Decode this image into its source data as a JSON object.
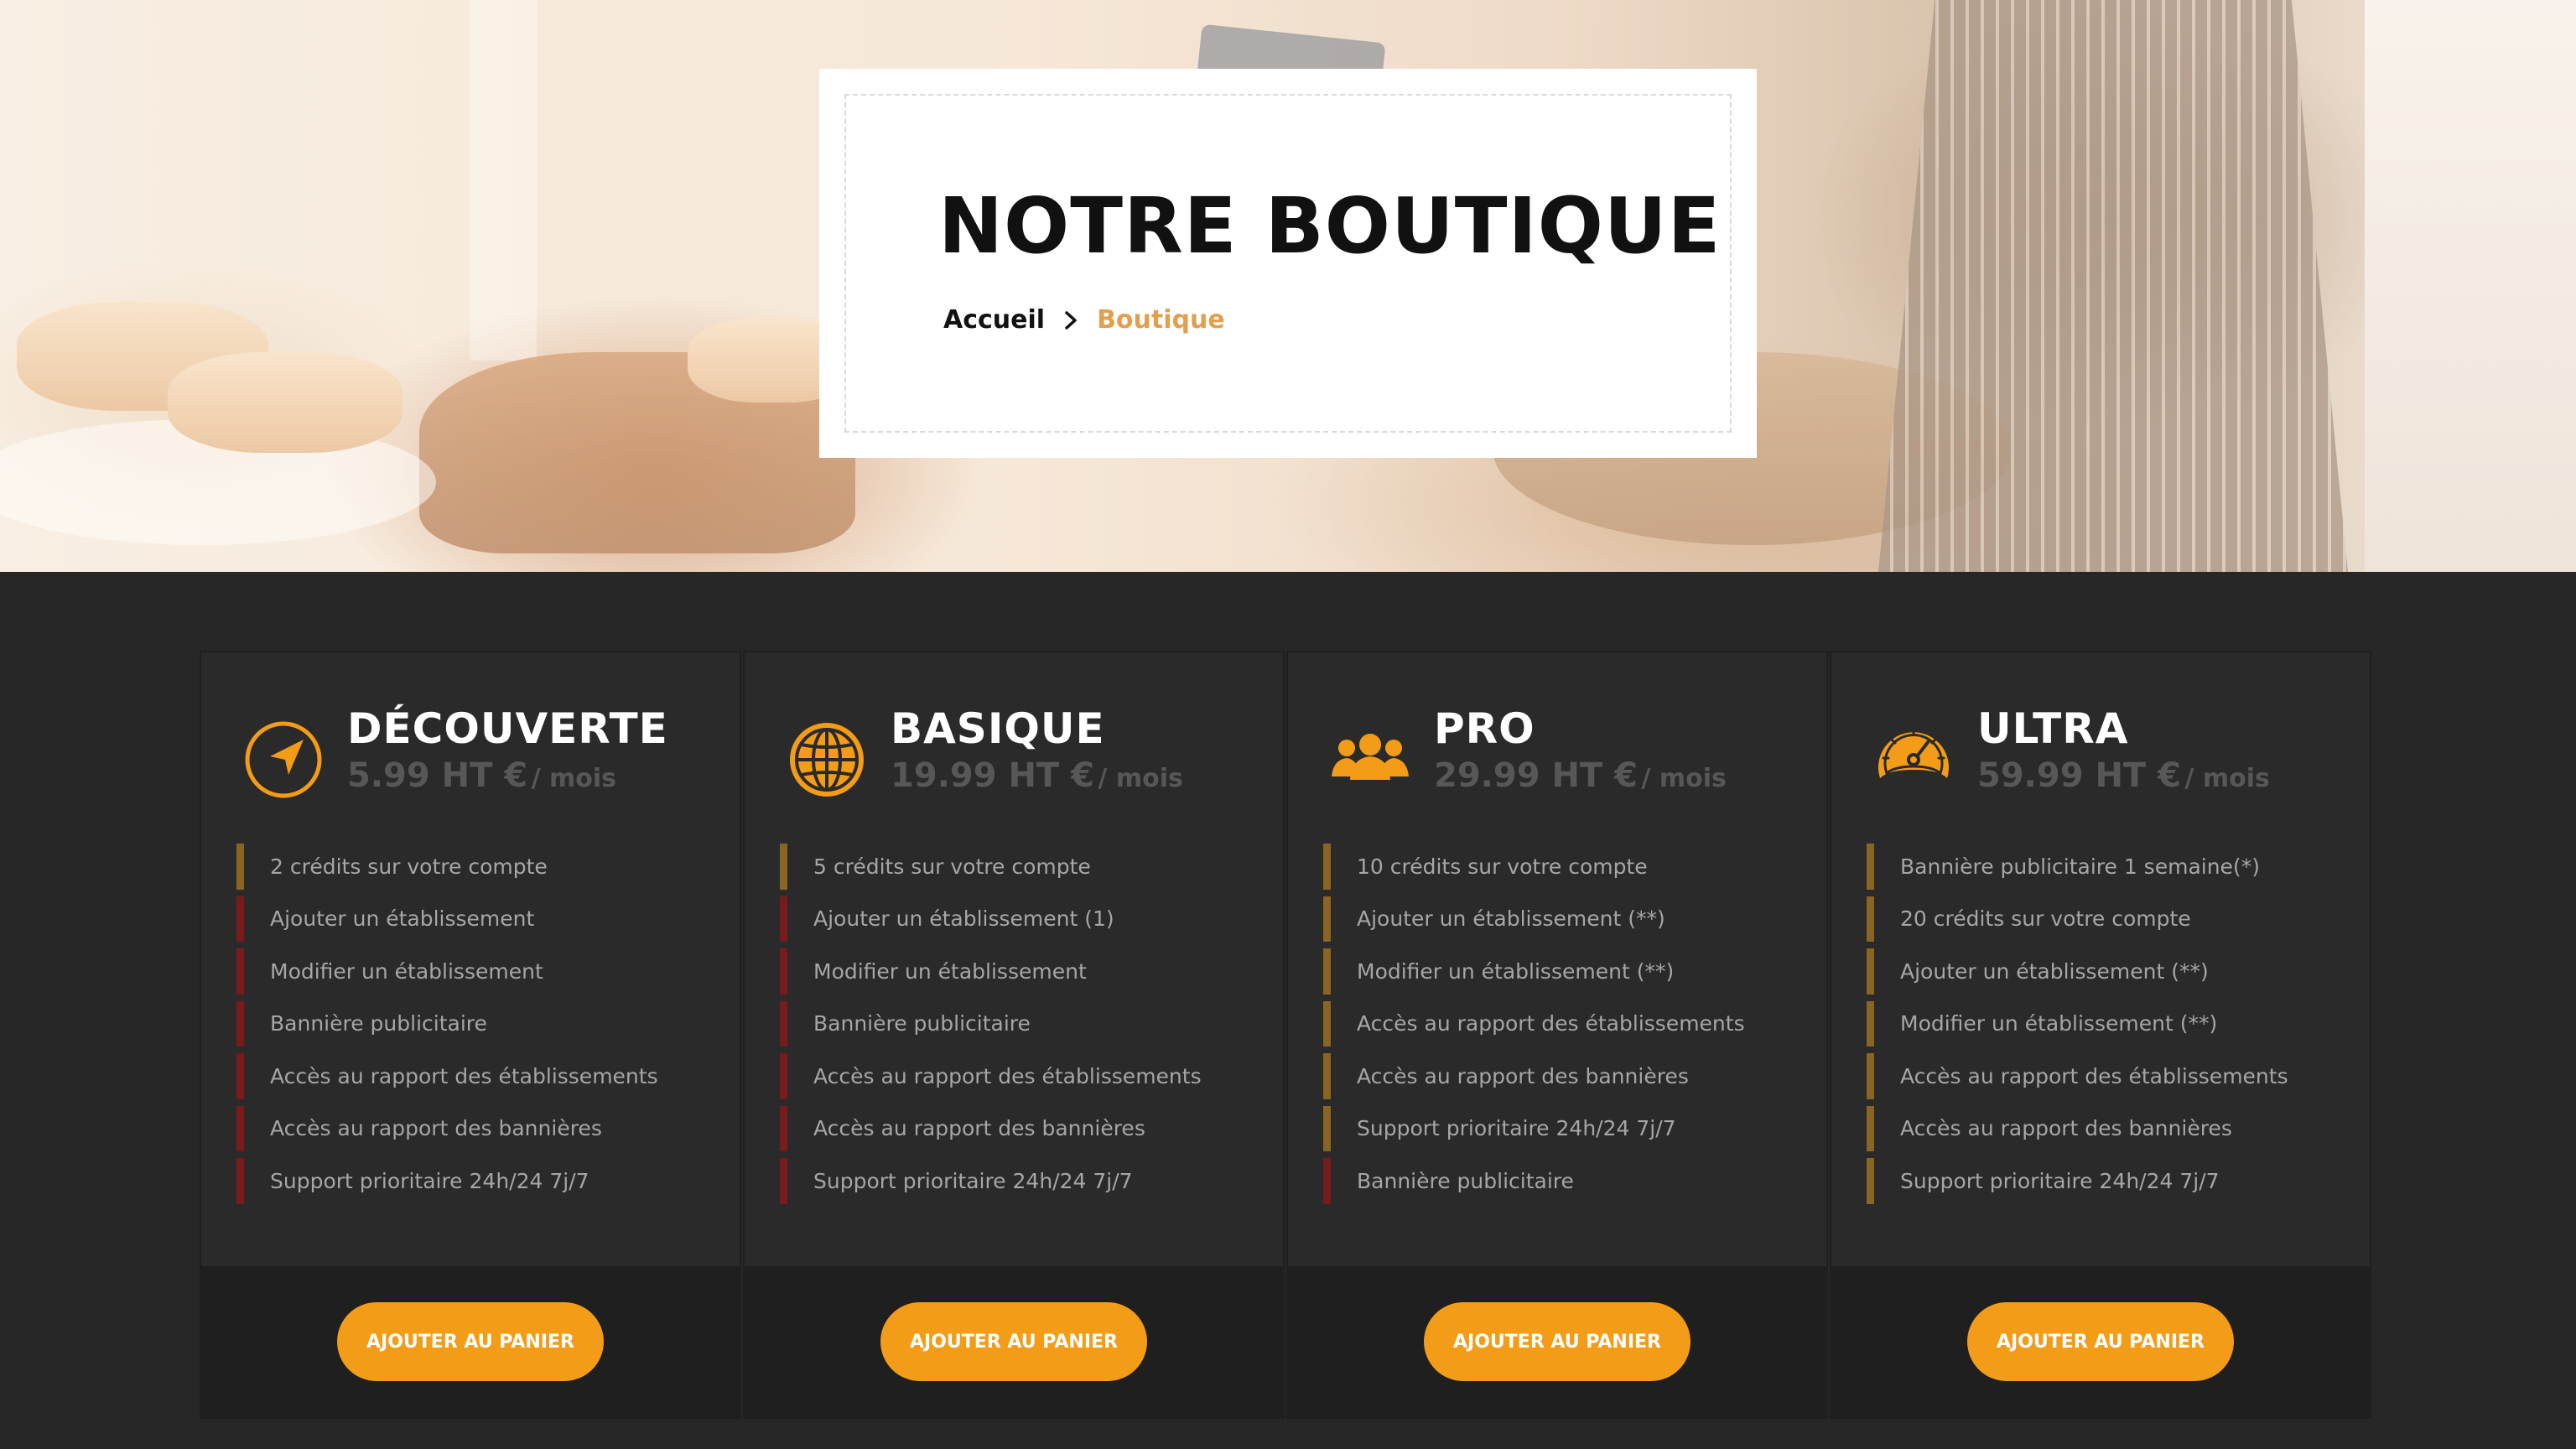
{
  "hero": {
    "title": "NOTRE BOUTIQUE",
    "breadcrumb": {
      "home": "Accueil",
      "current": "Boutique"
    }
  },
  "colors": {
    "accent": "#f39c18",
    "breadcrumb_current": "#e0a04f",
    "included_bar": "#8a6521",
    "excluded_bar": "#7a1b1b",
    "background": "#272727"
  },
  "plans": [
    {
      "name": "DÉCOUVERTE",
      "price": "5.99 HT €",
      "period": "/ mois",
      "icon": "navigation-arrow-icon",
      "features": [
        {
          "label": "2 crédits sur votre compte",
          "included": true
        },
        {
          "label": "Ajouter un établissement",
          "included": false
        },
        {
          "label": "Modifier un établissement",
          "included": false
        },
        {
          "label": "Bannière publicitaire",
          "included": false
        },
        {
          "label": "Accès au rapport des établissements",
          "included": false
        },
        {
          "label": "Accès au rapport des bannières",
          "included": false
        },
        {
          "label": "Support prioritaire 24h/24 7j/7",
          "included": false
        }
      ],
      "button": "AJOUTER AU PANIER"
    },
    {
      "name": "BASIQUE",
      "price": "19.99 HT €",
      "period": "/ mois",
      "icon": "globe-icon",
      "features": [
        {
          "label": "5 crédits sur votre compte",
          "included": true
        },
        {
          "label": "Ajouter un établissement (1)",
          "included": false
        },
        {
          "label": "Modifier un établissement",
          "included": false
        },
        {
          "label": "Bannière publicitaire",
          "included": false
        },
        {
          "label": "Accès au rapport des établissements",
          "included": false
        },
        {
          "label": "Accès au rapport des bannières",
          "included": false
        },
        {
          "label": "Support prioritaire 24h/24 7j/7",
          "included": false
        }
      ],
      "button": "AJOUTER AU PANIER"
    },
    {
      "name": "PRO",
      "price": "29.99 HT €",
      "period": "/ mois",
      "icon": "users-group-icon",
      "features": [
        {
          "label": "10 crédits sur votre compte",
          "included": true
        },
        {
          "label": "Ajouter un établissement (**)",
          "included": true
        },
        {
          "label": "Modifier un établissement (**)",
          "included": true
        },
        {
          "label": "Accès au rapport des établissements",
          "included": true
        },
        {
          "label": "Accès au rapport des bannières",
          "included": true
        },
        {
          "label": "Support prioritaire 24h/24 7j/7",
          "included": true
        },
        {
          "label": "Bannière publicitaire",
          "included": false
        }
      ],
      "button": "AJOUTER AU PANIER"
    },
    {
      "name": "ULTRA",
      "price": "59.99 HT €",
      "period": "/ mois",
      "icon": "speedometer-icon",
      "features": [
        {
          "label": "Bannière publicitaire 1 semaine(*)",
          "included": true
        },
        {
          "label": "20 crédits sur votre compte",
          "included": true
        },
        {
          "label": "Ajouter un établissement (**)",
          "included": true
        },
        {
          "label": "Modifier un établissement (**)",
          "included": true
        },
        {
          "label": "Accès au rapport des établissements",
          "included": true
        },
        {
          "label": "Accès au rapport des bannières",
          "included": true
        },
        {
          "label": "Support prioritaire 24h/24 7j/7",
          "included": true
        }
      ],
      "button": "AJOUTER AU PANIER"
    }
  ]
}
